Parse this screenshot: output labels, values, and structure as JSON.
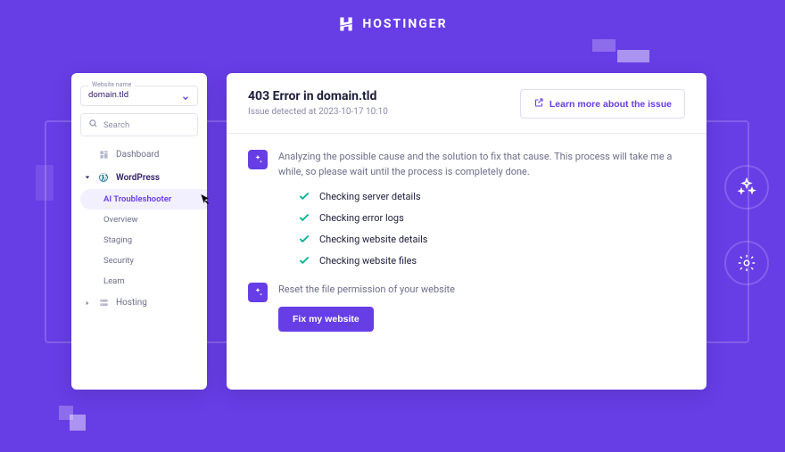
{
  "brand": {
    "name": "HOSTINGER"
  },
  "sidebar": {
    "website_label": "Website name",
    "website_value": "domain.tld",
    "search_placeholder": "Search",
    "sections": {
      "dashboard": "Dashboard",
      "wordpress": "WordPress",
      "hosting": "Hosting"
    },
    "wp_items": {
      "ai_troubleshooter": "AI Troubleshooter",
      "overview": "Overview",
      "staging": "Staging",
      "security": "Security",
      "learn": "Learn"
    }
  },
  "issue": {
    "title": "403 Error in domain.tld",
    "detected": "Issue detected at 2023-10-17 10:10",
    "learn_more": "Learn more about the issue"
  },
  "analysis": {
    "intro": "Analyzing the possible cause and the solution to fix that cause. This process will take me a while, so please wait until the process is completely done.",
    "checks": {
      "c1": "Checking server details",
      "c2": "Checking error logs",
      "c3": "Checking website details",
      "c4": "Checking website files"
    },
    "fix_intro": "Reset the file permission of your website",
    "fix_button": "Fix my website"
  },
  "colors": {
    "primary": "#673de6",
    "success": "#00b090"
  }
}
